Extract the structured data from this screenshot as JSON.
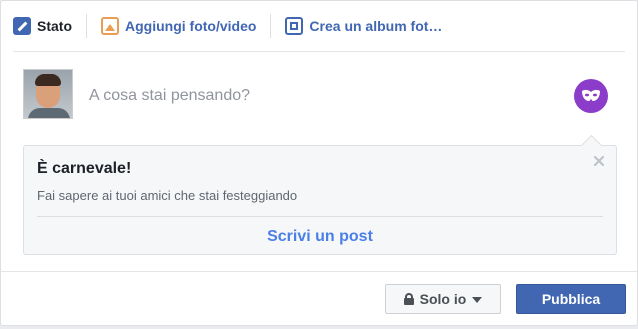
{
  "tabs": [
    {
      "label": "Stato",
      "icon": "pencil-icon"
    },
    {
      "label": "Aggiungi foto/video",
      "icon": "photo-icon"
    },
    {
      "label": "Crea un album fot…",
      "icon": "album-icon"
    }
  ],
  "composer": {
    "placeholder": "A cosa stai pensando?",
    "activity_icon": "carnival-mask-icon"
  },
  "card": {
    "title": "È carnevale!",
    "description": "Fai sapere ai tuoi amici che stai festeggiando",
    "cta": "Scrivi un post"
  },
  "footer": {
    "privacy_label": "Solo io",
    "publish_label": "Pubblica"
  },
  "colors": {
    "brand": "#4267b2",
    "mask_bg": "#8b3cc8",
    "cta": "#4a7fe8",
    "photo_accent": "#e99e53"
  }
}
